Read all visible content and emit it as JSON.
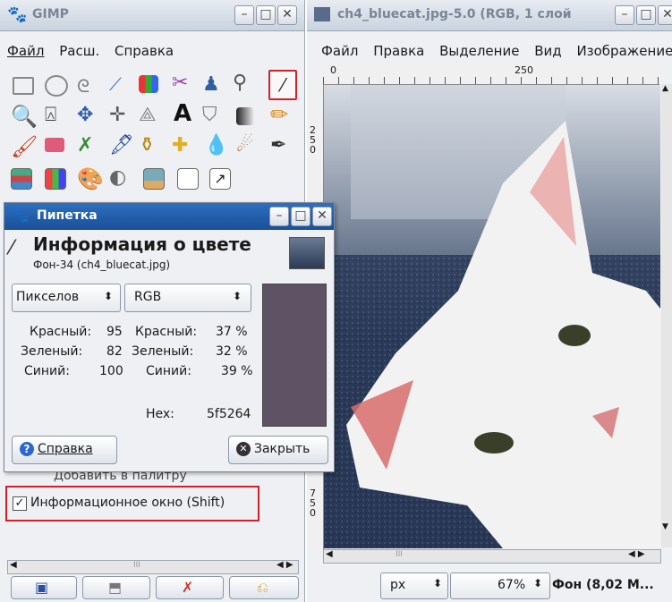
{
  "toolbox": {
    "title": "GIMP",
    "menu": [
      "Файл",
      "Расш.",
      "Справка"
    ],
    "checkbox_label": "Информационное окно (Shift)",
    "hidden_item": "Добавить в палитру",
    "scroll_mark": "III"
  },
  "image_window": {
    "title": "ch4_bluecat.jpg-5.0 (RGB, 1 слой",
    "menu": [
      "Файл",
      "Правка",
      "Выделение",
      "Вид",
      "Изображение"
    ],
    "ruler_h": [
      "0",
      "250"
    ],
    "ruler_v_top": "250",
    "ruler_v_bottom": "750",
    "unit": "px",
    "zoom": "67%",
    "status": "Фон (8,02 М...",
    "scroll_mark": "III"
  },
  "dialog": {
    "title": "Пипетка",
    "heading": "Информация о цвете",
    "subtitle": "Фон-34 (ch4_bluecat.jpg)",
    "left_mode": "Пикселов",
    "right_mode": "RGB",
    "left_values": [
      {
        "label": "Красный:",
        "value": "95"
      },
      {
        "label": "Зеленый:",
        "value": "82"
      },
      {
        "label": "Синий:",
        "value": "100"
      }
    ],
    "right_values": [
      {
        "label": "Красный:",
        "value": "37 %"
      },
      {
        "label": "Зеленый:",
        "value": "32 %"
      },
      {
        "label": "Синий:",
        "value": "39 %"
      }
    ],
    "hex_label": "Hex:",
    "hex_value": "5f5264",
    "swatch_color": "#5f5264",
    "help_label": "Справка",
    "close_label": "Закрыть"
  },
  "colors": {
    "selection_red": "#d0202a",
    "help_blue": "#2a66d4"
  }
}
